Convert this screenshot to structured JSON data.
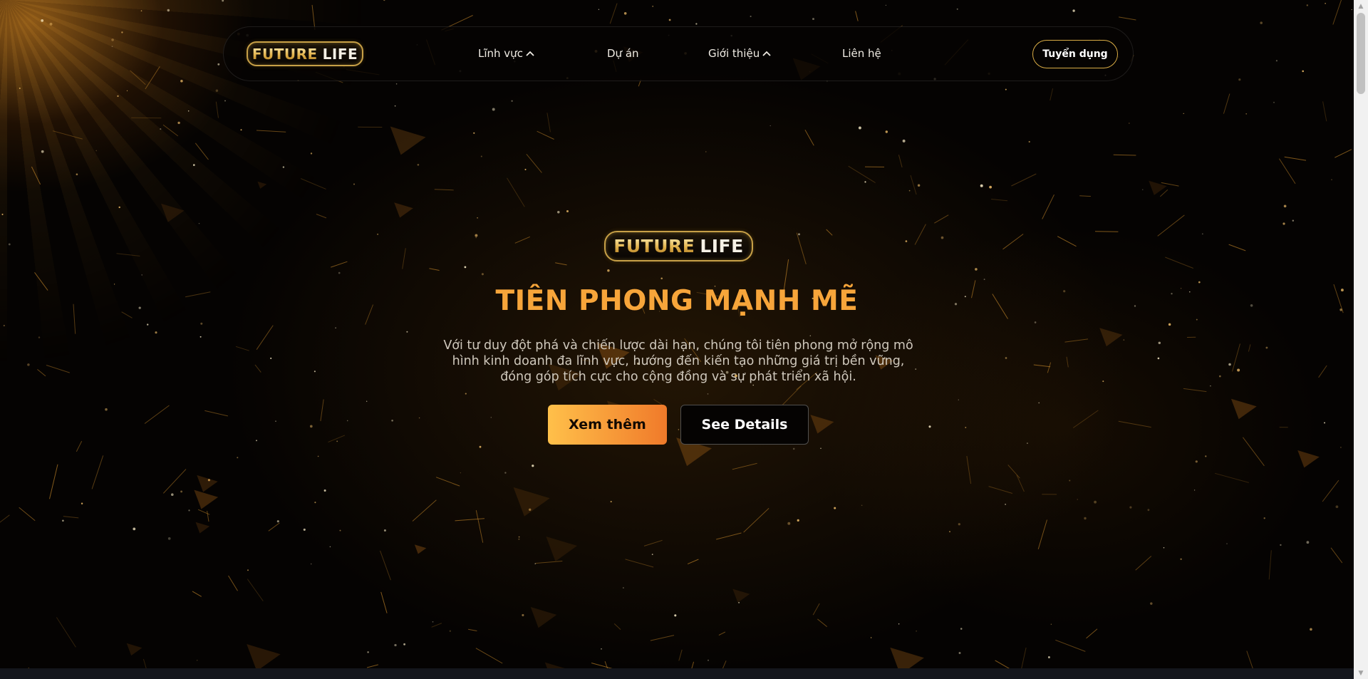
{
  "brand": {
    "logo_word_1": "FUTURE",
    "logo_word_2": "LIFE",
    "gold": "#d9ac45",
    "accent_orange": "#f7a53a"
  },
  "nav": {
    "items": [
      {
        "label": "Lĩnh vực",
        "has_dropdown": true,
        "icon": "chevron-up-icon"
      },
      {
        "label": "Dự án",
        "has_dropdown": false
      },
      {
        "label": "Giới thiệu",
        "has_dropdown": true,
        "icon": "chevron-up-icon"
      },
      {
        "label": "Liên hệ",
        "has_dropdown": false
      }
    ],
    "cta_label": "Tuyển dụng"
  },
  "hero": {
    "title": "TIÊN PHONG MẠNH MẼ",
    "description_lines": [
      "Với tư duy đột phá và chiến lược dài hạn, chúng tôi tiên phong mở rộng mô",
      "hình kinh doanh đa lĩnh vực, hướng đến kiến tạo những giá trị bền vững,",
      "đóng góp tích cực cho cộng đồng và sự phát triển xã hội."
    ],
    "primary_button": "Xem thêm",
    "secondary_button": "See Details"
  },
  "scrollbar": {
    "up_icon": "▲",
    "down_icon": "▼"
  }
}
